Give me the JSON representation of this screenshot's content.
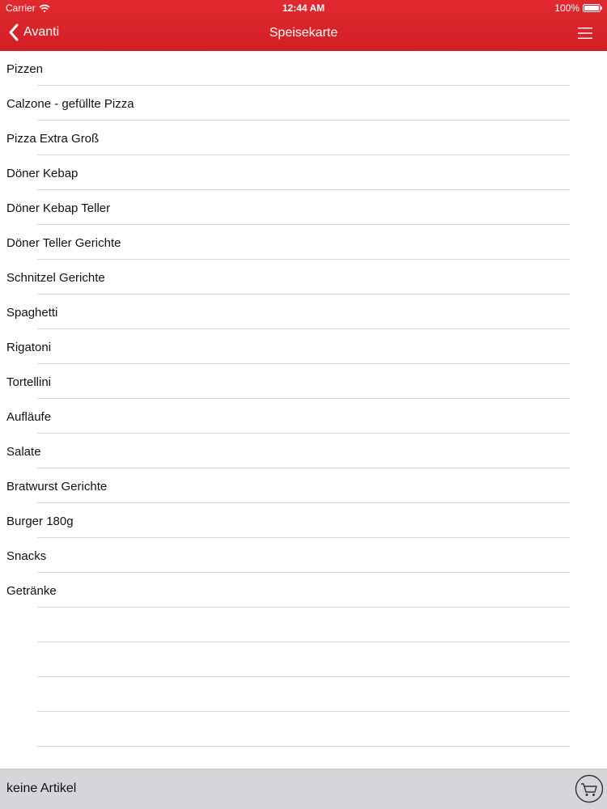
{
  "status_bar": {
    "carrier": "Carrier",
    "time": "12:44 AM",
    "battery": "100%"
  },
  "nav": {
    "back_label": "Avanti",
    "title": "Speisekarte"
  },
  "colors": {
    "accent": "#d9232a",
    "bottom_bar": "#d6d5da"
  },
  "icons": {
    "wifi": "wifi-icon",
    "battery": "battery-icon",
    "back": "chevron-left-icon",
    "menu": "hamburger-menu-icon",
    "cart": "shopping-cart-icon"
  },
  "menu_categories": [
    {
      "label": "Pizzen"
    },
    {
      "label": "Calzone - gefüllte Pizza"
    },
    {
      "label": "Pizza Extra Groß"
    },
    {
      "label": "Döner Kebap"
    },
    {
      "label": "Döner Kebap Teller"
    },
    {
      "label": "Döner Teller Gerichte"
    },
    {
      "label": "Schnitzel Gerichte"
    },
    {
      "label": "Spaghetti"
    },
    {
      "label": "Rigatoni"
    },
    {
      "label": "Tortellini"
    },
    {
      "label": "Aufläufe"
    },
    {
      "label": "Salate"
    },
    {
      "label": "Bratwurst Gerichte"
    },
    {
      "label": "Burger 180g"
    },
    {
      "label": "Snacks"
    },
    {
      "label": "Getränke"
    },
    {
      "label": ""
    },
    {
      "label": ""
    },
    {
      "label": ""
    },
    {
      "label": ""
    }
  ],
  "cart": {
    "status_text": "keine Artikel"
  }
}
